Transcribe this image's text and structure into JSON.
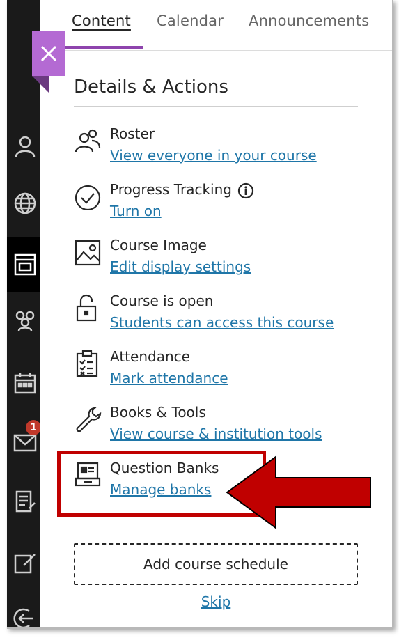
{
  "tabs": [
    {
      "label": "Content",
      "active": true
    },
    {
      "label": "Calendar",
      "active": false
    },
    {
      "label": "Announcements",
      "active": false
    }
  ],
  "panel": {
    "title": "Details & Actions",
    "items": [
      {
        "label": "Roster",
        "link": "View everyone in your course",
        "icon": "roster-icon"
      },
      {
        "label": "Progress Tracking",
        "link": "Turn on",
        "icon": "progress-check-icon"
      },
      {
        "label": "Course Image",
        "link": "Edit display settings",
        "icon": "image-icon"
      },
      {
        "label": "Course is open",
        "link": "Students can access this course",
        "icon": "unlock-icon"
      },
      {
        "label": "Attendance",
        "link": "Mark attendance",
        "icon": "attendance-clipboard-icon"
      },
      {
        "label": "Books & Tools",
        "link": "View course & institution tools",
        "icon": "wrench-icon"
      },
      {
        "label": "Question Banks",
        "link": "Manage banks",
        "icon": "question-bank-icon"
      }
    ],
    "schedule_button": "Add course schedule",
    "skip_link": "Skip"
  },
  "leftnav": {
    "badge_count": "1",
    "icons": [
      "profile-icon",
      "globe-icon",
      "courses-icon",
      "groups-icon",
      "calendar-icon",
      "messages-icon",
      "grades-icon",
      "edit-icon",
      "sign-out-icon"
    ]
  },
  "colors": {
    "accent": "#8e44ad",
    "close_tab": "#b46ad3",
    "link": "#1f76a8",
    "highlight": "#c00000",
    "nav_bg": "#1a1a1a"
  }
}
